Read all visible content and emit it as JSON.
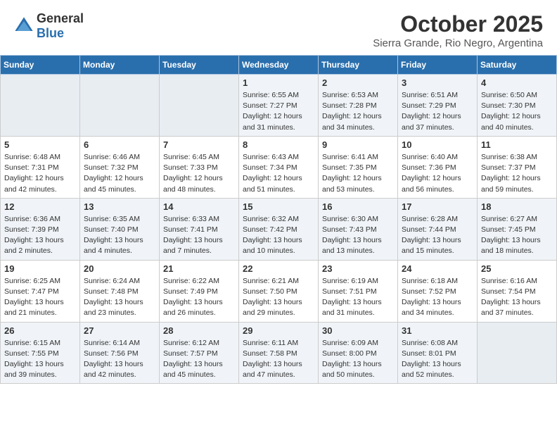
{
  "header": {
    "logo_general": "General",
    "logo_blue": "Blue",
    "month": "October 2025",
    "location": "Sierra Grande, Rio Negro, Argentina"
  },
  "weekdays": [
    "Sunday",
    "Monday",
    "Tuesday",
    "Wednesday",
    "Thursday",
    "Friday",
    "Saturday"
  ],
  "weeks": [
    [
      {
        "day": "",
        "info": ""
      },
      {
        "day": "",
        "info": ""
      },
      {
        "day": "",
        "info": ""
      },
      {
        "day": "1",
        "info": "Sunrise: 6:55 AM\nSunset: 7:27 PM\nDaylight: 12 hours\nand 31 minutes."
      },
      {
        "day": "2",
        "info": "Sunrise: 6:53 AM\nSunset: 7:28 PM\nDaylight: 12 hours\nand 34 minutes."
      },
      {
        "day": "3",
        "info": "Sunrise: 6:51 AM\nSunset: 7:29 PM\nDaylight: 12 hours\nand 37 minutes."
      },
      {
        "day": "4",
        "info": "Sunrise: 6:50 AM\nSunset: 7:30 PM\nDaylight: 12 hours\nand 40 minutes."
      }
    ],
    [
      {
        "day": "5",
        "info": "Sunrise: 6:48 AM\nSunset: 7:31 PM\nDaylight: 12 hours\nand 42 minutes."
      },
      {
        "day": "6",
        "info": "Sunrise: 6:46 AM\nSunset: 7:32 PM\nDaylight: 12 hours\nand 45 minutes."
      },
      {
        "day": "7",
        "info": "Sunrise: 6:45 AM\nSunset: 7:33 PM\nDaylight: 12 hours\nand 48 minutes."
      },
      {
        "day": "8",
        "info": "Sunrise: 6:43 AM\nSunset: 7:34 PM\nDaylight: 12 hours\nand 51 minutes."
      },
      {
        "day": "9",
        "info": "Sunrise: 6:41 AM\nSunset: 7:35 PM\nDaylight: 12 hours\nand 53 minutes."
      },
      {
        "day": "10",
        "info": "Sunrise: 6:40 AM\nSunset: 7:36 PM\nDaylight: 12 hours\nand 56 minutes."
      },
      {
        "day": "11",
        "info": "Sunrise: 6:38 AM\nSunset: 7:37 PM\nDaylight: 12 hours\nand 59 minutes."
      }
    ],
    [
      {
        "day": "12",
        "info": "Sunrise: 6:36 AM\nSunset: 7:39 PM\nDaylight: 13 hours\nand 2 minutes."
      },
      {
        "day": "13",
        "info": "Sunrise: 6:35 AM\nSunset: 7:40 PM\nDaylight: 13 hours\nand 4 minutes."
      },
      {
        "day": "14",
        "info": "Sunrise: 6:33 AM\nSunset: 7:41 PM\nDaylight: 13 hours\nand 7 minutes."
      },
      {
        "day": "15",
        "info": "Sunrise: 6:32 AM\nSunset: 7:42 PM\nDaylight: 13 hours\nand 10 minutes."
      },
      {
        "day": "16",
        "info": "Sunrise: 6:30 AM\nSunset: 7:43 PM\nDaylight: 13 hours\nand 13 minutes."
      },
      {
        "day": "17",
        "info": "Sunrise: 6:28 AM\nSunset: 7:44 PM\nDaylight: 13 hours\nand 15 minutes."
      },
      {
        "day": "18",
        "info": "Sunrise: 6:27 AM\nSunset: 7:45 PM\nDaylight: 13 hours\nand 18 minutes."
      }
    ],
    [
      {
        "day": "19",
        "info": "Sunrise: 6:25 AM\nSunset: 7:47 PM\nDaylight: 13 hours\nand 21 minutes."
      },
      {
        "day": "20",
        "info": "Sunrise: 6:24 AM\nSunset: 7:48 PM\nDaylight: 13 hours\nand 23 minutes."
      },
      {
        "day": "21",
        "info": "Sunrise: 6:22 AM\nSunset: 7:49 PM\nDaylight: 13 hours\nand 26 minutes."
      },
      {
        "day": "22",
        "info": "Sunrise: 6:21 AM\nSunset: 7:50 PM\nDaylight: 13 hours\nand 29 minutes."
      },
      {
        "day": "23",
        "info": "Sunrise: 6:19 AM\nSunset: 7:51 PM\nDaylight: 13 hours\nand 31 minutes."
      },
      {
        "day": "24",
        "info": "Sunrise: 6:18 AM\nSunset: 7:52 PM\nDaylight: 13 hours\nand 34 minutes."
      },
      {
        "day": "25",
        "info": "Sunrise: 6:16 AM\nSunset: 7:54 PM\nDaylight: 13 hours\nand 37 minutes."
      }
    ],
    [
      {
        "day": "26",
        "info": "Sunrise: 6:15 AM\nSunset: 7:55 PM\nDaylight: 13 hours\nand 39 minutes."
      },
      {
        "day": "27",
        "info": "Sunrise: 6:14 AM\nSunset: 7:56 PM\nDaylight: 13 hours\nand 42 minutes."
      },
      {
        "day": "28",
        "info": "Sunrise: 6:12 AM\nSunset: 7:57 PM\nDaylight: 13 hours\nand 45 minutes."
      },
      {
        "day": "29",
        "info": "Sunrise: 6:11 AM\nSunset: 7:58 PM\nDaylight: 13 hours\nand 47 minutes."
      },
      {
        "day": "30",
        "info": "Sunrise: 6:09 AM\nSunset: 8:00 PM\nDaylight: 13 hours\nand 50 minutes."
      },
      {
        "day": "31",
        "info": "Sunrise: 6:08 AM\nSunset: 8:01 PM\nDaylight: 13 hours\nand 52 minutes."
      },
      {
        "day": "",
        "info": ""
      }
    ]
  ]
}
